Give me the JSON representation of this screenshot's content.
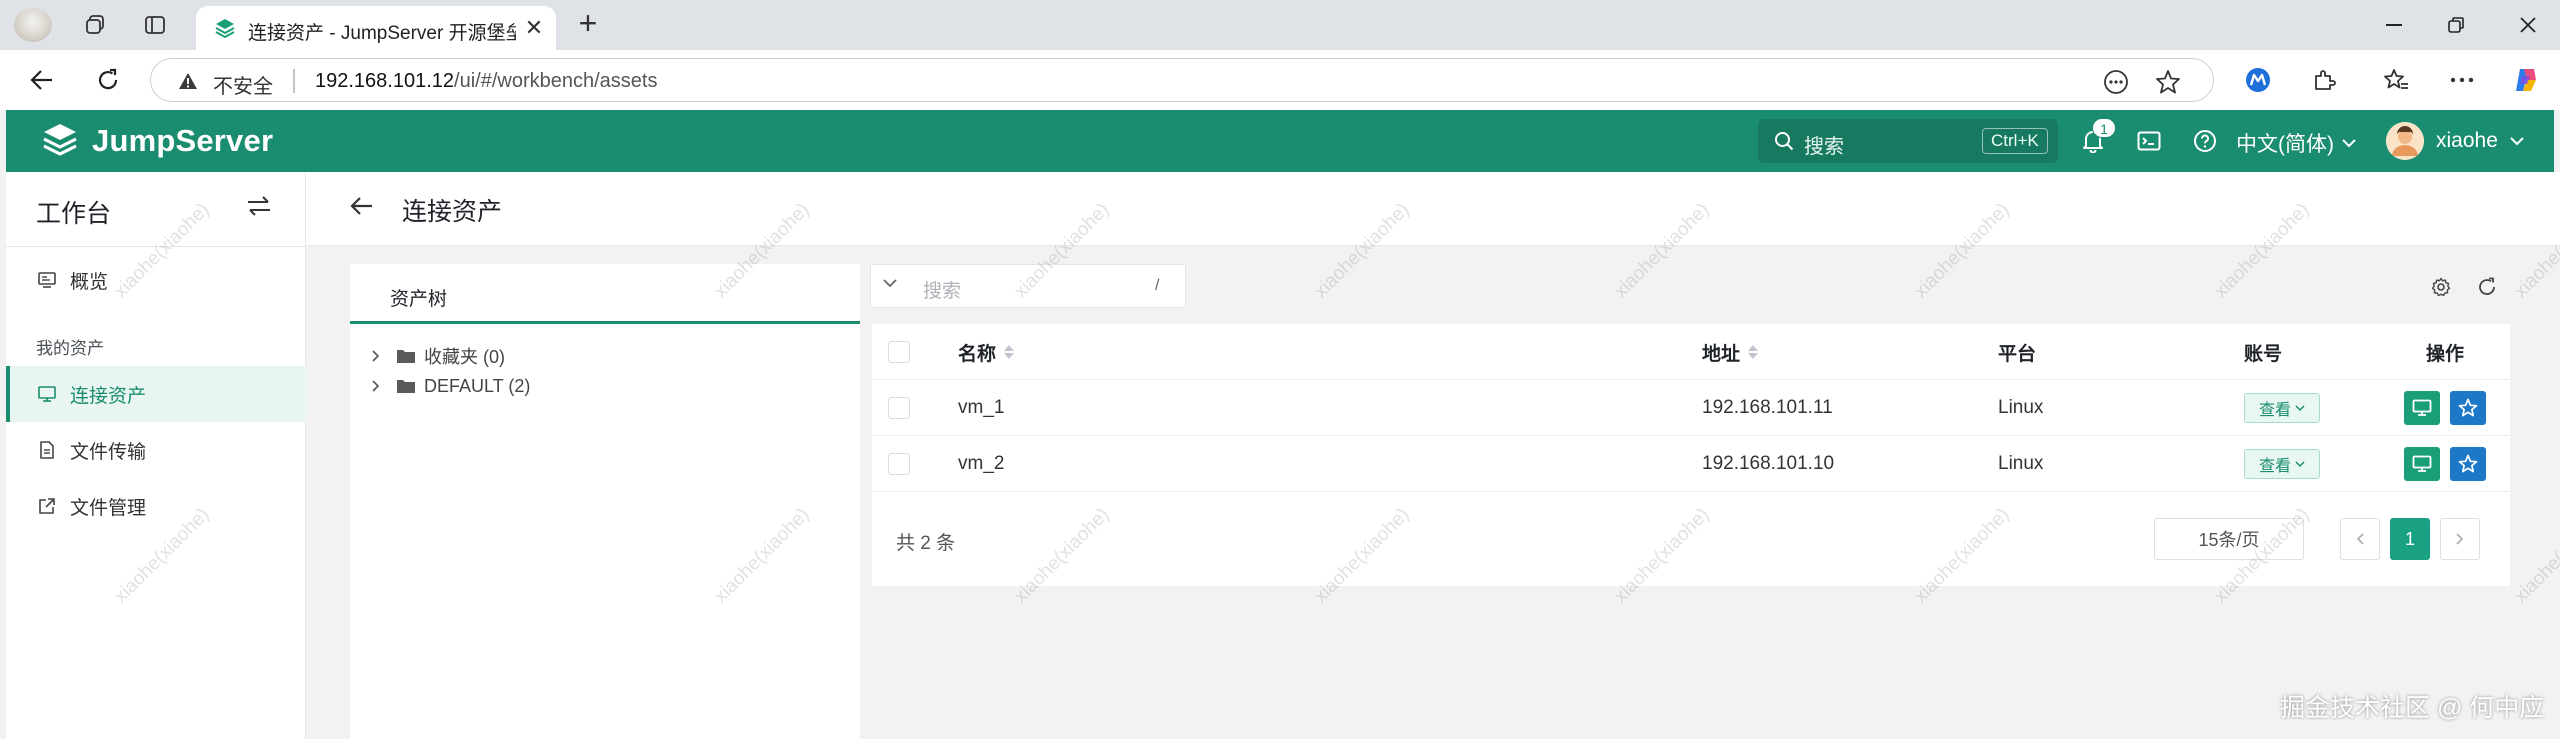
{
  "browser": {
    "tab_title": "连接资产 - JumpServer 开源堡垒机",
    "url_prefix": "192.168.101.12",
    "url_path": "/ui/#/workbench/assets",
    "insecure_label": "不安全"
  },
  "header": {
    "brand": "JumpServer",
    "search_placeholder": "搜索",
    "search_shortcut": "Ctrl+K",
    "notification_count": "1",
    "language": "中文(简体)",
    "username": "xiaohe"
  },
  "sidebar": {
    "title": "工作台",
    "section_label": "我的资产",
    "items": [
      {
        "label": "概览",
        "icon": "monitor-icon"
      },
      {
        "label": "连接资产",
        "icon": "desktop-icon"
      },
      {
        "label": "文件传输",
        "icon": "file-icon"
      },
      {
        "label": "文件管理",
        "icon": "external-link-icon"
      }
    ]
  },
  "page": {
    "title": "连接资产"
  },
  "tree": {
    "tab_label": "资产树",
    "nodes": [
      {
        "label": "收藏夹 (0)"
      },
      {
        "label": "DEFAULT (2)"
      }
    ]
  },
  "table": {
    "search_placeholder": "搜索",
    "search_shortcut": "/",
    "columns": [
      "名称",
      "地址",
      "平台",
      "账号",
      "操作"
    ],
    "rows": [
      {
        "name": "vm_1",
        "address": "192.168.101.11",
        "platform": "Linux",
        "account_label": "查看"
      },
      {
        "name": "vm_2",
        "address": "192.168.101.10",
        "platform": "Linux",
        "account_label": "查看"
      }
    ],
    "total_label": "共 2 条",
    "page_size": "15条/页",
    "current_page": "1"
  },
  "watermark_text": "xiaohe(xiaohe)",
  "credit": "掘金技术社区 @ 何中应",
  "colors": {
    "brand": "#1a8d70",
    "primary_button": "#1a9e78",
    "favorite_button": "#1e78c8"
  }
}
